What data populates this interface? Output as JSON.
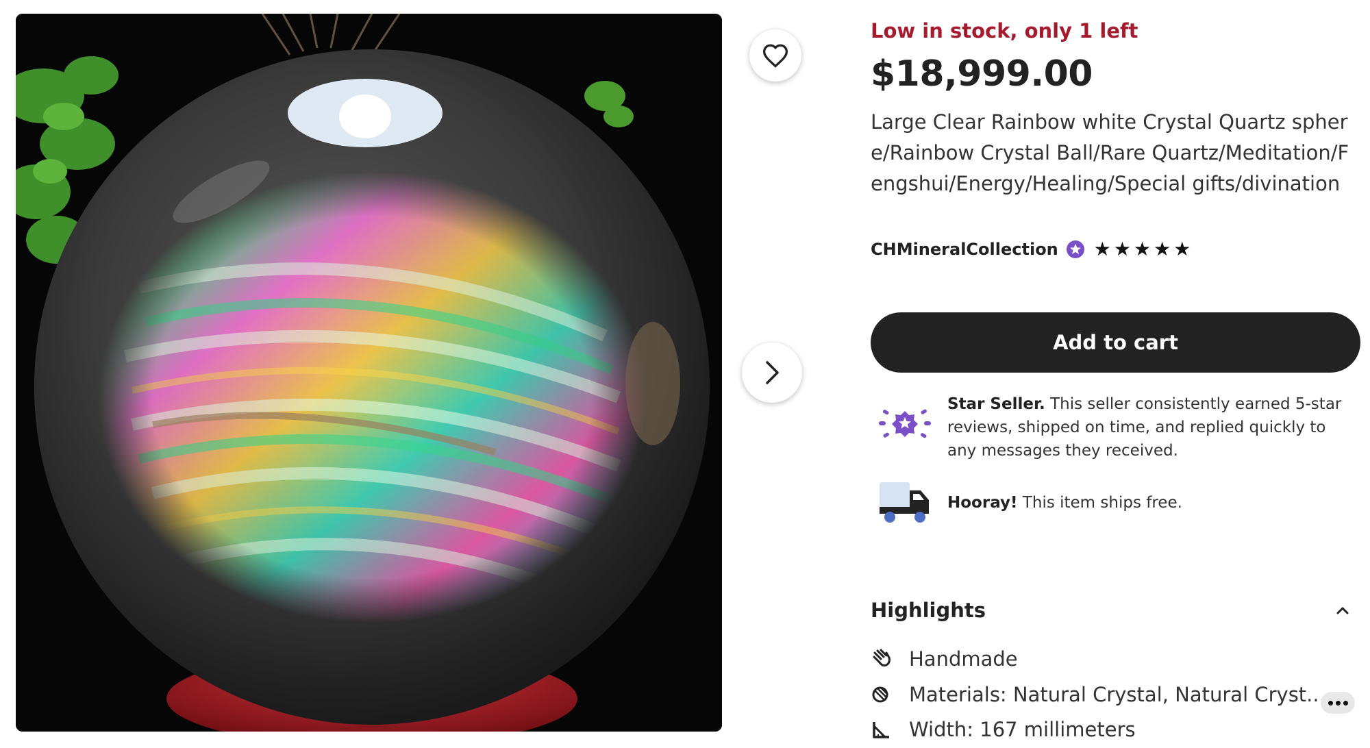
{
  "listing": {
    "stock_notice": "Low in stock, only 1 left",
    "price": "$18,999.00",
    "title": "Large Clear Rainbow white Crystal Quartz sphere/Rainbow Crystal Ball/Rare Quartz/Meditation/Fengshui/Energy/Healing/Special gifts/divination",
    "shop_name": "CHMineralCollection",
    "rating_stars": 5,
    "add_to_cart_label": "Add to cart"
  },
  "perks": {
    "star_seller_bold": "Star Seller.",
    "star_seller_text": " This seller consistently earned 5-star reviews, shipped on time, and replied quickly to any messages they received.",
    "shipping_bold": "Hooray!",
    "shipping_text": " This item ships free."
  },
  "highlights": {
    "title": "Highlights",
    "items": [
      {
        "icon": "hand-icon",
        "text": "Handmade"
      },
      {
        "icon": "materials-icon",
        "text": "Materials: Natural Crystal, Natural Cryst..."
      },
      {
        "icon": "ruler-icon",
        "text": "Width: 167 millimeters"
      }
    ]
  },
  "colors": {
    "stock_red": "#a61a2e",
    "button_dark": "#222222",
    "star_seller_purple": "#7b4fc7",
    "truck_blue": "#4d6ec5"
  }
}
